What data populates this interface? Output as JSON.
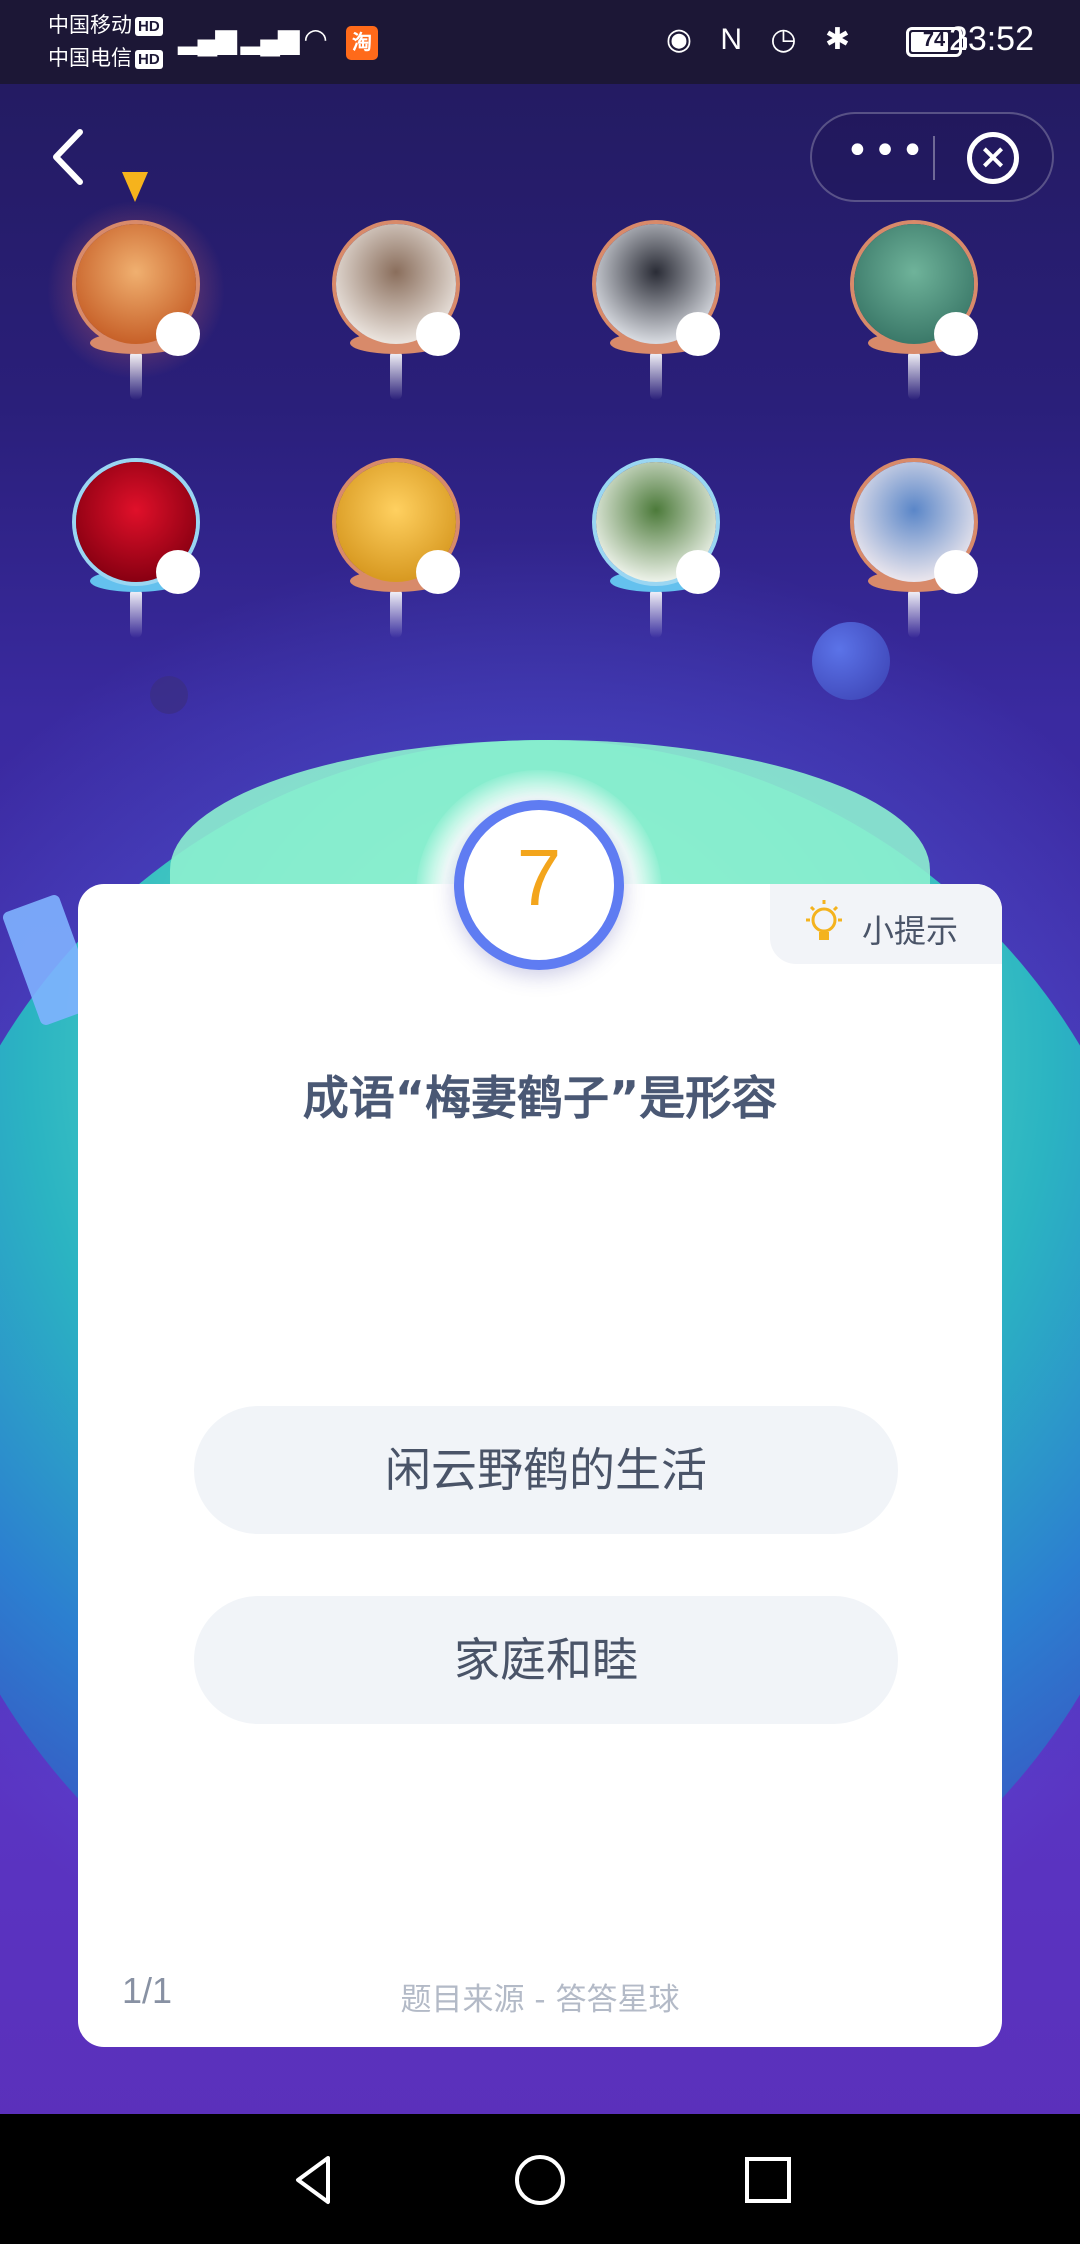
{
  "status_bar": {
    "carrier1": "中国移动",
    "carrier2": "中国电信",
    "hd_badge": "HD",
    "signal": "4G 4G",
    "shop_icon": "淘",
    "battery": "74",
    "time": "23:52"
  },
  "controls": {
    "back_icon": "chevron-left-icon",
    "more_label": "•••",
    "close_label": "×"
  },
  "players": [
    {
      "name": "player-1",
      "colors": [
        "#c8622a",
        "#f0b070"
      ],
      "active": true
    },
    {
      "name": "player-2",
      "colors": [
        "#e9e2dc",
        "#8a6e5c"
      ],
      "active": false
    },
    {
      "name": "player-3",
      "colors": [
        "#d6d9df",
        "#2a2c36"
      ],
      "active": false
    },
    {
      "name": "player-4",
      "colors": [
        "#3c7a6a",
        "#6fb39a"
      ],
      "active": false
    },
    {
      "name": "player-5",
      "colors": [
        "#8a0012",
        "#e0102a"
      ],
      "active": false
    },
    {
      "name": "player-6",
      "colors": [
        "#d89a22",
        "#ffd060"
      ],
      "active": false
    },
    {
      "name": "player-7",
      "colors": [
        "#eaf0e6",
        "#4c7a3a"
      ],
      "active": false
    },
    {
      "name": "player-8",
      "colors": [
        "#e8e4ec",
        "#5a86c8"
      ],
      "active": false
    }
  ],
  "quiz": {
    "timer": "7",
    "hint_label": "小提示",
    "question": "成语“梅妻鹤子”是形容",
    "options": [
      "闲云野鹤的生活",
      "家庭和睦"
    ],
    "page": "1/1",
    "source": "题目来源 - 答答星球"
  },
  "colors": {
    "accent": "#5f7cf2",
    "timer_number": "#f3a51c",
    "card": "#ffffff"
  }
}
